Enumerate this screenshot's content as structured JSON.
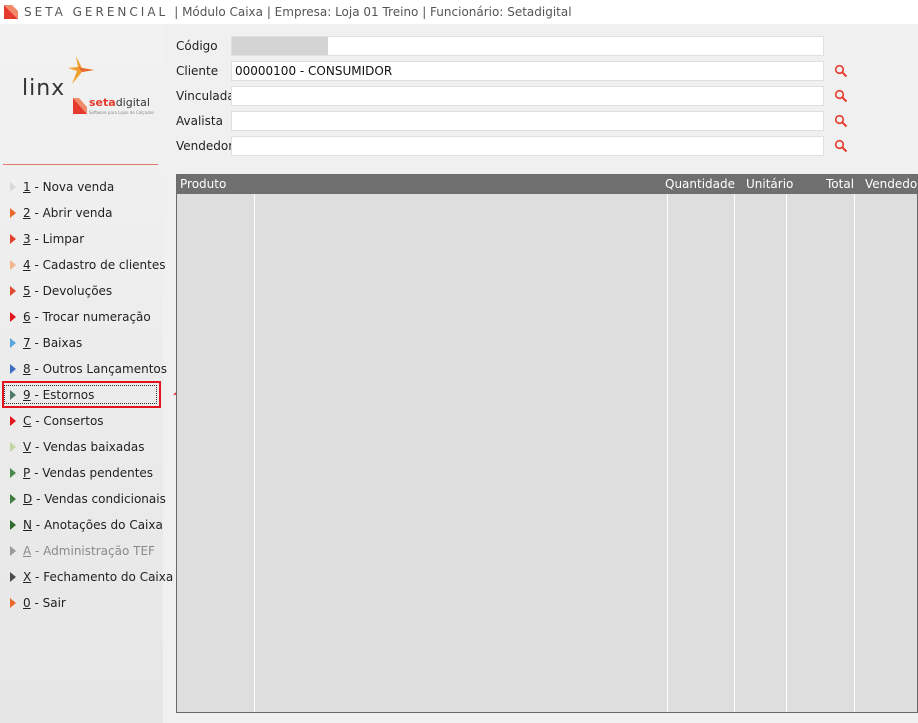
{
  "titlebar": {
    "brand": "SETA GERENCIAL",
    "rest": "| Módulo Caixa | Empresa: Loja 01 Treino | Funcionário: Setadigital"
  },
  "logo": {
    "linx": "linx",
    "seta_prefix": "seta",
    "seta_suffix": "digital",
    "seta_sub": "Software para Lojas de Calçados"
  },
  "menu": [
    {
      "key": "1",
      "label": " - Nova venda",
      "color": "#d9d9d9"
    },
    {
      "key": "2",
      "label": " - Abrir venda",
      "color": "#e8692e"
    },
    {
      "key": "3",
      "label": " - Limpar",
      "color": "#e5402b"
    },
    {
      "key": "4",
      "label": " - Cadastro de clientes",
      "color": "#f2b48a"
    },
    {
      "key": "5",
      "label": " - Devoluções",
      "color": "#e04a2e"
    },
    {
      "key": "6",
      "label": " - Trocar numeração",
      "color": "#e3141b"
    },
    {
      "key": "7",
      "label": " - Baixas",
      "color": "#5aa5dc"
    },
    {
      "key": "8",
      "label": " - Outros Lançamentos",
      "color": "#3f6fc7"
    },
    {
      "key": "9",
      "label": " - Estornos",
      "color": "#4d7d68"
    },
    {
      "key": "C",
      "label": " - Consertos",
      "color": "#e3141b"
    },
    {
      "key": "V",
      "label": " - Vendas baixadas",
      "color": "#c5d6a5"
    },
    {
      "key": "P",
      "label": " - Vendas pendentes",
      "color": "#4a8a4a"
    },
    {
      "key": "D",
      "label": " - Vendas condicionais",
      "color": "#3e7d3e"
    },
    {
      "key": "N",
      "label": " - Anotações do Caixa",
      "color": "#2f6b2f"
    },
    {
      "key": "A",
      "label": " - Administração TEF",
      "color": "#9a9a9a"
    },
    {
      "key": "X",
      "label": " - Fechamento do Caixa",
      "color": "#4a4a4a"
    },
    {
      "key": "0",
      "label": " - Sair",
      "color": "#e8692e"
    }
  ],
  "form": {
    "codigo_label": "Código",
    "cliente_label": "Cliente",
    "cliente_value": "00000100 - CONSUMIDOR",
    "vinculada_label": "Vinculada",
    "avalista_label": "Avalista",
    "vendedor_label": "Vendedor"
  },
  "grid": {
    "columns": [
      "Produto",
      "Quantidade",
      "Unitário",
      "Total",
      "Vendedor"
    ]
  },
  "colors": {
    "accent": "#e53a2d",
    "highlight": "#e3141b",
    "grid_header": "#6f6f6f",
    "search_icon": "#e53a2d"
  }
}
